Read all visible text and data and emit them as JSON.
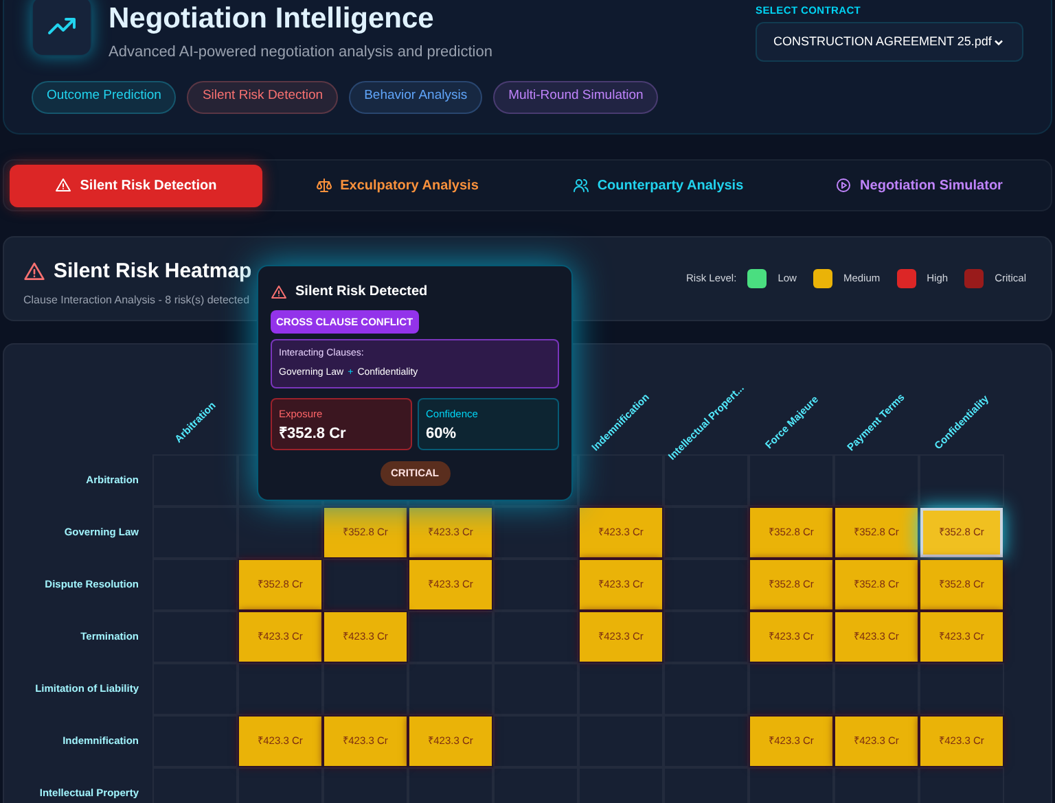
{
  "header": {
    "title": "Negotiation Intelligence",
    "subtitle": "Advanced AI-powered negotiation analysis and prediction",
    "features": [
      {
        "label": "Outcome Prediction",
        "color": "#22d3ee"
      },
      {
        "label": "Silent Risk Detection",
        "color": "#f87171"
      },
      {
        "label": "Behavior Analysis",
        "color": "#60a5fa"
      },
      {
        "label": "Multi-Round Simulation",
        "color": "#c084fc"
      }
    ],
    "contract_select": {
      "label": "SELECT CONTRACT",
      "value": "CONSTRUCTION AGREEMENT 25.pdf"
    }
  },
  "tabs": [
    {
      "label": "Silent Risk Detection",
      "color": "#ffffff",
      "selected": true
    },
    {
      "label": "Exculpatory Analysis",
      "color": "#fb923c",
      "selected": false
    },
    {
      "label": "Counterparty Analysis",
      "color": "#22d3ee",
      "selected": false
    },
    {
      "label": "Negotiation Simulator",
      "color": "#c084fc",
      "selected": false
    }
  ],
  "heatmap": {
    "title": "Silent Risk Heatmap",
    "subtitle": "Clause Interaction Analysis - 8 risk(s) detected",
    "legend_label": "Risk Level:",
    "legend": [
      {
        "label": "Low",
        "color": "#4ade80"
      },
      {
        "label": "Medium",
        "color": "#eab308"
      },
      {
        "label": "High",
        "color": "#dc2626"
      },
      {
        "label": "Critical",
        "color": "#991b1b"
      }
    ],
    "columns": [
      {
        "label": "Arbitration"
      },
      {},
      {},
      {},
      {},
      {
        "label": "Indemnification"
      },
      {
        "label": "Intellectual Propert..."
      },
      {
        "label": "Force Majeure"
      },
      {
        "label": "Payment Terms"
      },
      {
        "label": "Confidentiality"
      }
    ],
    "rows": [
      {
        "label": "Arbitration",
        "cells": [
          null,
          null,
          null,
          null,
          null,
          null,
          null,
          null,
          null,
          null
        ]
      },
      {
        "label": "Governing Law",
        "cells": [
          null,
          null,
          {
            "value": "₹352.8 Cr",
            "selected": false
          },
          {
            "value": "₹423.3 Cr",
            "selected": false
          },
          null,
          {
            "value": "₹423.3 Cr",
            "selected": false
          },
          null,
          {
            "value": "₹352.8 Cr",
            "selected": false
          },
          {
            "value": "₹352.8 Cr",
            "selected": false
          },
          {
            "value": "₹352.8 Cr",
            "selected": true
          }
        ]
      },
      {
        "label": "Dispute Resolution",
        "cells": [
          null,
          {
            "value": "₹352.8 Cr",
            "selected": false
          },
          null,
          {
            "value": "₹423.3 Cr",
            "selected": false
          },
          null,
          {
            "value": "₹423.3 Cr",
            "selected": false
          },
          null,
          {
            "value": "₹352.8 Cr",
            "selected": false
          },
          {
            "value": "₹352.8 Cr",
            "selected": false
          },
          {
            "value": "₹352.8 Cr",
            "selected": false
          }
        ]
      },
      {
        "label": "Termination",
        "cells": [
          null,
          {
            "value": "₹423.3 Cr",
            "selected": false
          },
          {
            "value": "₹423.3 Cr",
            "selected": false
          },
          null,
          null,
          {
            "value": "₹423.3 Cr",
            "selected": false
          },
          null,
          {
            "value": "₹423.3 Cr",
            "selected": false
          },
          {
            "value": "₹423.3 Cr",
            "selected": false
          },
          {
            "value": "₹423.3 Cr",
            "selected": false
          }
        ]
      },
      {
        "label": "Limitation of Liability",
        "cells": [
          null,
          null,
          null,
          null,
          null,
          null,
          null,
          null,
          null,
          null
        ]
      },
      {
        "label": "Indemnification",
        "cells": [
          null,
          {
            "value": "₹423.3 Cr",
            "selected": false
          },
          {
            "value": "₹423.3 Cr",
            "selected": false
          },
          {
            "value": "₹423.3 Cr",
            "selected": false
          },
          null,
          null,
          null,
          {
            "value": "₹423.3 Cr",
            "selected": false
          },
          {
            "value": "₹423.3 Cr",
            "selected": false
          },
          {
            "value": "₹423.3 Cr",
            "selected": false
          }
        ]
      },
      {
        "label": "Intellectual Property",
        "cells": [
          null,
          null,
          null,
          null,
          null,
          null,
          null,
          null,
          null,
          null
        ]
      }
    ],
    "tooltip": {
      "title": "Silent Risk Detected",
      "tag": "CROSS CLAUSE CONFLICT",
      "clauses_label": "Interacting Clauses:",
      "clause_a": "Governing Law",
      "joiner": "+",
      "clause_b": "Confidentiality",
      "exposure_label": "Exposure",
      "exposure": "₹352.8 Cr",
      "confidence_label": "Confidence",
      "confidence": "60%",
      "severity": "CRITICAL"
    }
  }
}
